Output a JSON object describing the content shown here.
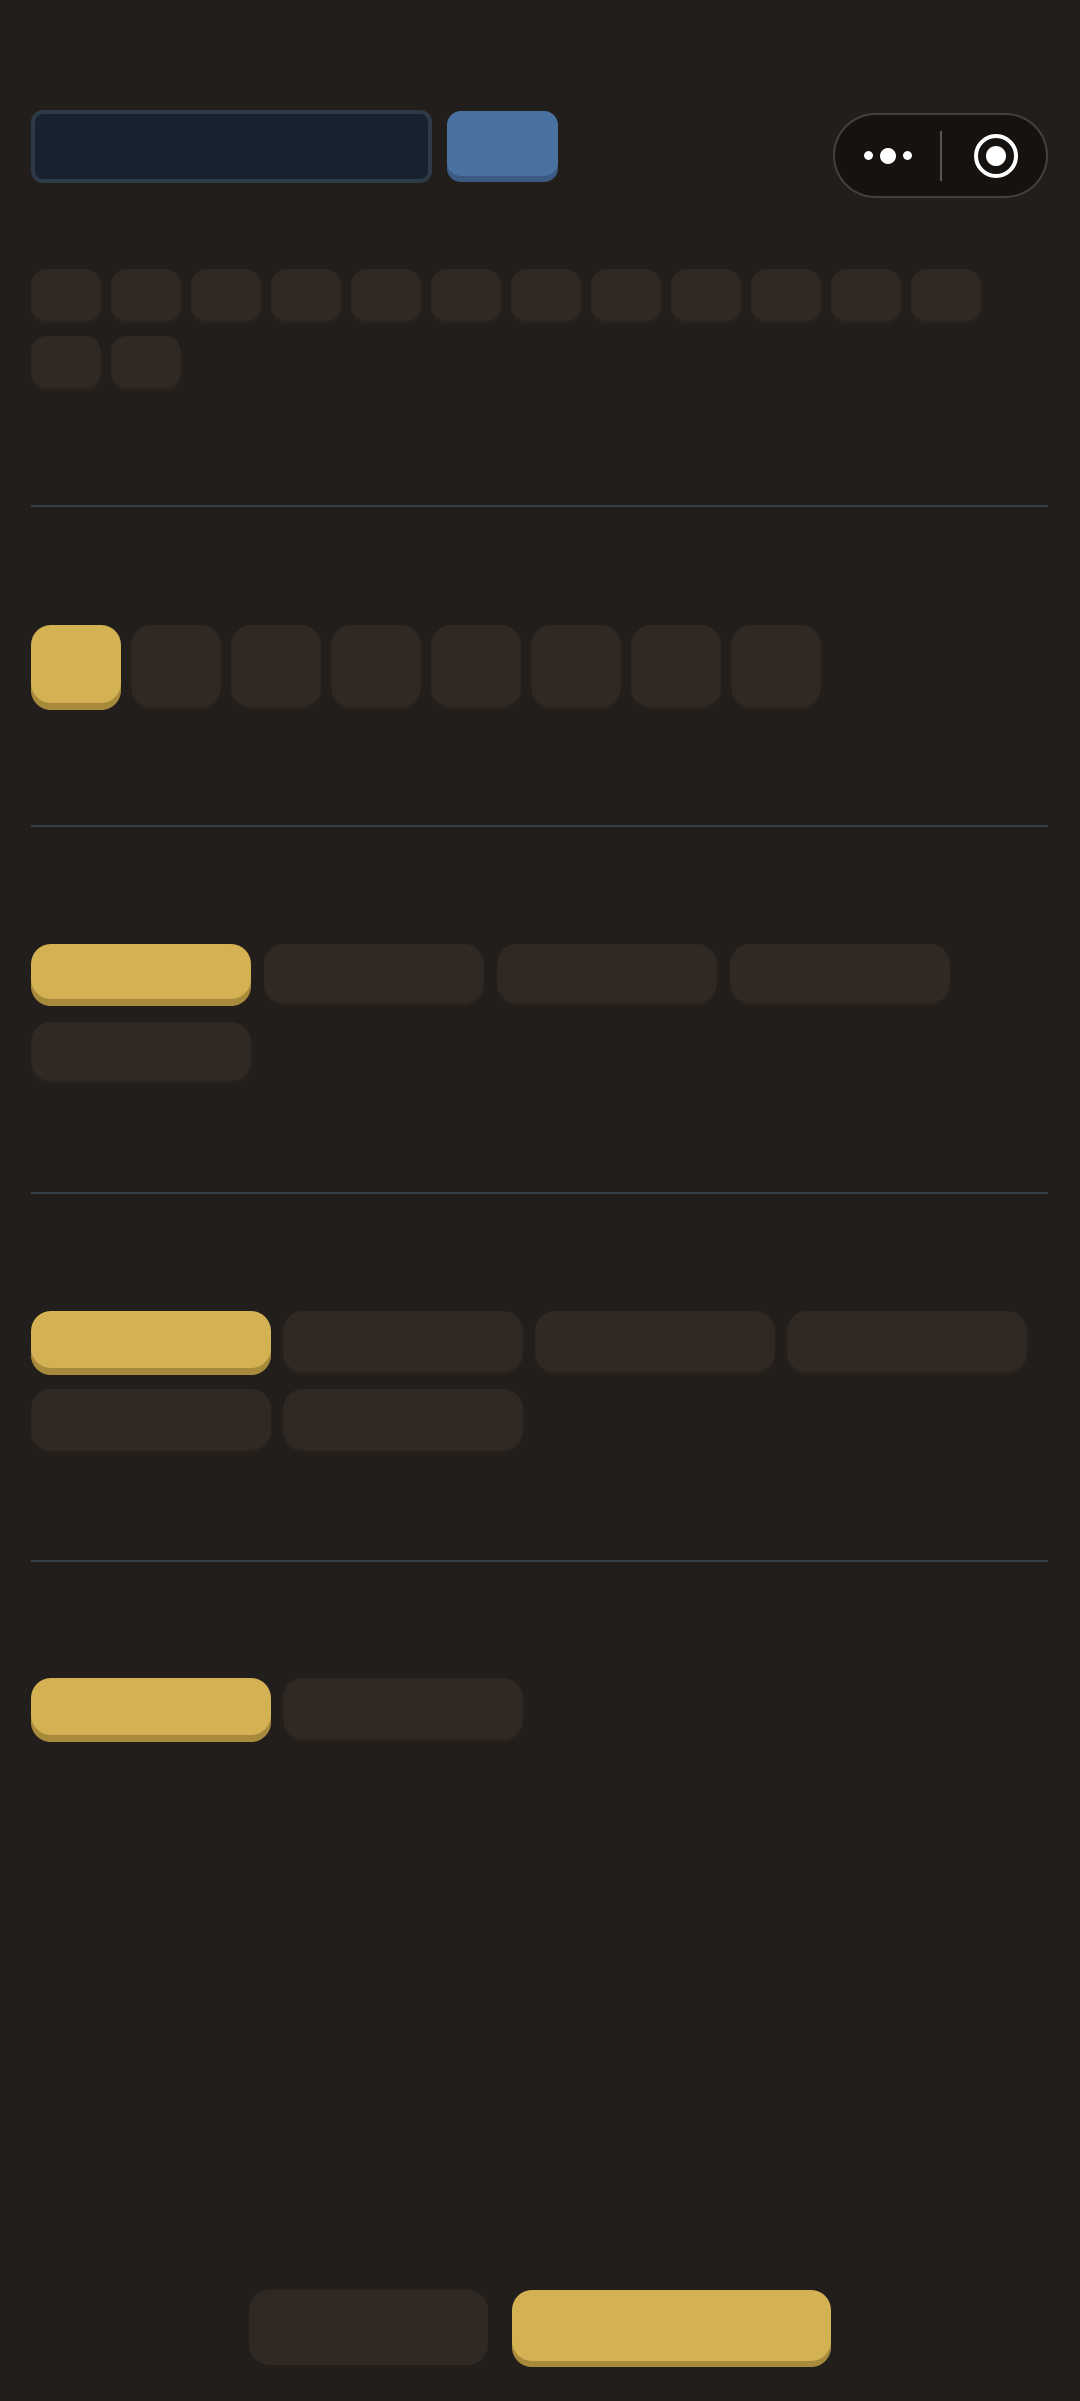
{
  "header": {
    "search_placeholder": "",
    "search_value": "",
    "search_button_label": ""
  },
  "capsule": {
    "more_icon": "more-dots-icon",
    "close_icon": "target-close-icon"
  },
  "section1": {
    "chips": [
      "",
      "",
      "",
      "",
      "",
      "",
      "",
      "",
      "",
      "",
      "",
      "",
      "",
      ""
    ]
  },
  "section2": {
    "chips": [
      "",
      "",
      "",
      "",
      "",
      "",
      "",
      ""
    ],
    "selected_index": 0
  },
  "section3": {
    "chips": [
      "",
      "",
      "",
      "",
      ""
    ],
    "selected_index": 0
  },
  "section4": {
    "chips": [
      "",
      "",
      "",
      "",
      "",
      ""
    ],
    "selected_index": 0
  },
  "section5": {
    "chips": [
      "",
      ""
    ],
    "selected_index": 0
  },
  "footer": {
    "secondary_label": "",
    "primary_label": ""
  },
  "colors": {
    "background": "#221e1b",
    "accent": "#d4b254",
    "search_button": "#4a72a1",
    "chip": "#302822",
    "divider": "#34414c"
  }
}
